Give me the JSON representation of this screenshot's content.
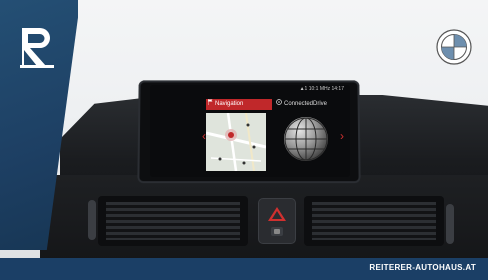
{
  "screen": {
    "status_text": "▲1  10:1 MHz 14:17",
    "tabs": [
      {
        "label": "Navigation",
        "icon": "navigation-flag-icon",
        "active": true
      },
      {
        "label": "ConnectedDrive",
        "icon": "connected-drive-icon",
        "active": false
      }
    ]
  },
  "brand": {
    "dealer_logo": "R",
    "car_logo": "BMW",
    "website": "REITERER-AUTOHAUS.AT",
    "accent_color": "#1b3f66",
    "nav_tab_color": "#c0282a"
  }
}
